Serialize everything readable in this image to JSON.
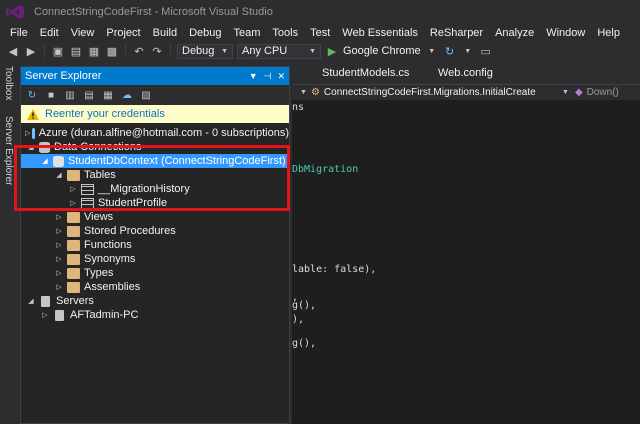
{
  "window": {
    "title": "ConnectStringCodeFirst - Microsoft Visual Studio"
  },
  "menu": [
    "File",
    "Edit",
    "View",
    "Project",
    "Build",
    "Debug",
    "Team",
    "Tools",
    "Test",
    "Web Essentials",
    "ReSharper",
    "Analyze",
    "Window",
    "Help"
  ],
  "toolbar": {
    "configuration": "Debug",
    "platform": "Any CPU",
    "run_target": "Google Chrome"
  },
  "side_tabs": [
    "Toolbox",
    "Server Explorer"
  ],
  "server_explorer": {
    "title": "Server Explorer",
    "warning": "Reenter your credentials",
    "tree": {
      "azure": "Azure (duran.alfine@hotmail.com - 0 subscriptions)",
      "data_connections": "Data Connections",
      "db_context": "StudentDbContext (ConnectStringCodeFirst)",
      "tables": "Tables",
      "migration_history": "__MigrationHistory",
      "student_profile": "StudentProfile",
      "views": "Views",
      "stored_procedures": "Stored Procedures",
      "functions": "Functions",
      "synonyms": "Synonyms",
      "types": "Types",
      "assemblies": "Assemblies",
      "servers": "Servers",
      "machine": "AFTadmin-PC"
    }
  },
  "editor": {
    "tabs": [
      "StudentModels.cs",
      "Web.config"
    ],
    "nav_left": "ConnectStringCodeFirst.Migrations.InitialCreate",
    "nav_right": "Down()",
    "code_fragments": {
      "l1": "ns",
      "l2": "DbMigration",
      "l3": "lable: false),",
      "l4": ",",
      "l5": "g(),",
      "l6": "),",
      "l7": "g(),"
    }
  },
  "colors": {
    "accent": "#007acc",
    "selection": "#3399ff",
    "highlight_box": "#e5141a",
    "warning_bg": "#fefcc8"
  }
}
